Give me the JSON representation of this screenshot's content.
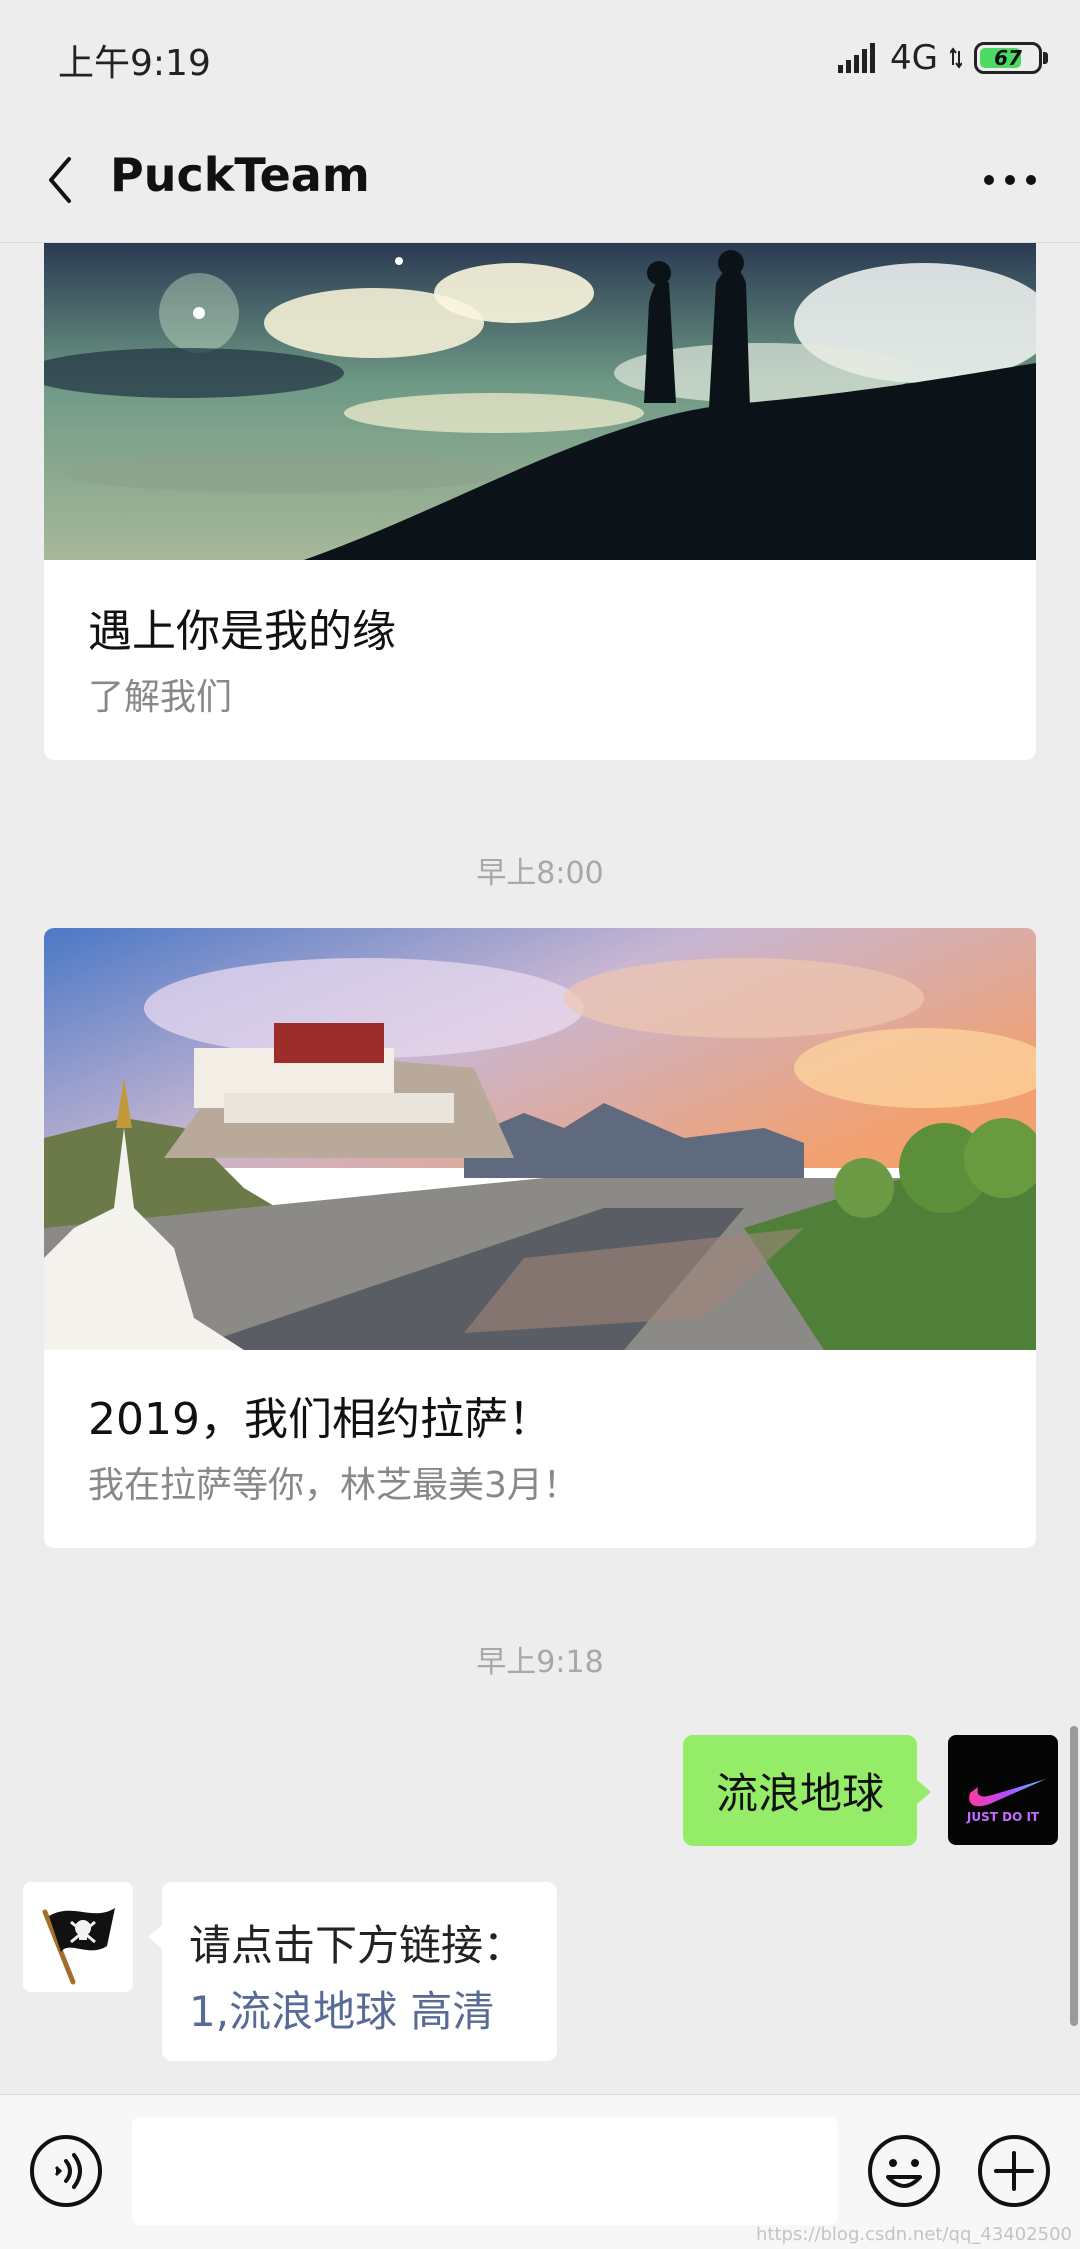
{
  "status_bar": {
    "time": "上午9:19",
    "network": "4G",
    "battery": "67"
  },
  "header": {
    "title": "PuckTeam"
  },
  "cards": [
    {
      "title": "遇上你是我的缘",
      "subtitle": "了解我们"
    },
    {
      "title": "2019，我们相约拉萨！",
      "subtitle": "我在拉萨等你，林芝最美3月！"
    }
  ],
  "timestamps": [
    "早上8:00",
    "早上9:18"
  ],
  "messages": {
    "outgoing": {
      "text": "流浪地球"
    },
    "incoming": {
      "line1": "请点击下方链接：",
      "link": "1,流浪地球 高清"
    }
  },
  "avatars": {
    "self_badge": "JUST DO IT"
  },
  "input_bar": {
    "placeholder": ""
  },
  "watermark": "https://blog.csdn.net/qq_43402500",
  "colors": {
    "outgoing_bubble": "#95ec69",
    "link": "#576b95",
    "background": "#ededed"
  },
  "icons": [
    "back-arrow-icon",
    "more-dots-icon",
    "voice-icon",
    "emoji-icon",
    "plus-icon"
  ]
}
